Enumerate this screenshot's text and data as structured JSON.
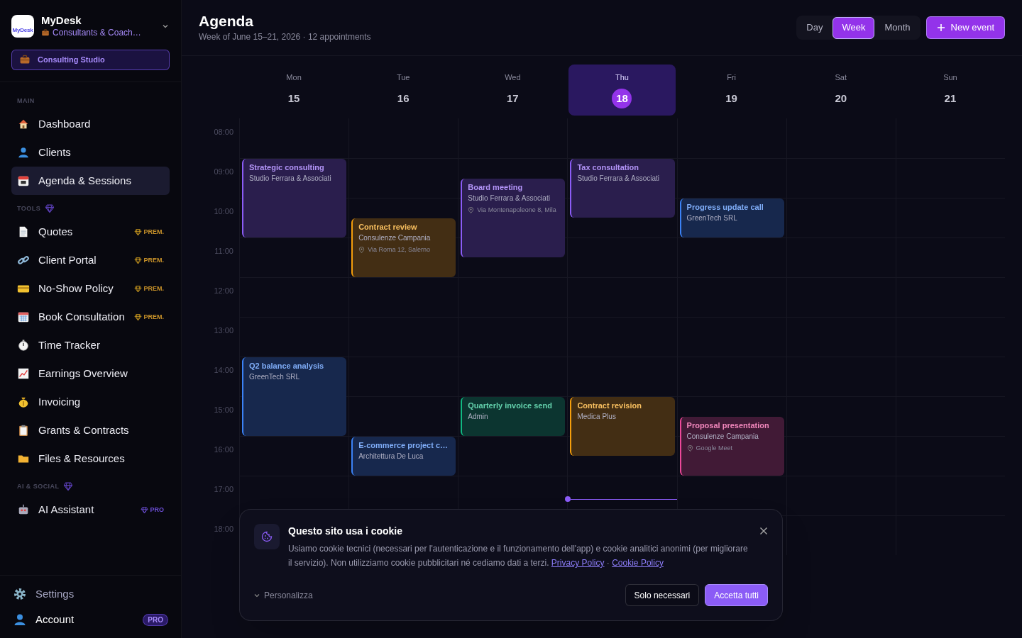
{
  "sidebar": {
    "logo_text": "MyDesk",
    "app_name": "MyDesk",
    "workspace": "Consultants & Coach…",
    "studio_button": "Consulting Studio",
    "sections": [
      {
        "label": "MAIN",
        "premium_icon": false,
        "items": [
          {
            "label": "Dashboard",
            "selected": false
          },
          {
            "label": "Clients",
            "selected": false
          },
          {
            "label": "Agenda & Sessions",
            "selected": true
          }
        ]
      },
      {
        "label": "TOOLS",
        "premium_icon": true,
        "items": [
          {
            "label": "Quotes",
            "selected": false,
            "badge": {
              "label": "PREM.",
              "kind": "premium"
            }
          },
          {
            "label": "Client Portal",
            "selected": false,
            "badge": {
              "label": "PREM.",
              "kind": "premium"
            }
          },
          {
            "label": "No-Show Policy",
            "selected": false,
            "badge": {
              "label": "PREM.",
              "kind": "premium"
            }
          },
          {
            "label": "Book Consultation",
            "selected": false,
            "badge": {
              "label": "PREM.",
              "kind": "premium"
            }
          },
          {
            "label": "Time Tracker",
            "selected": false
          },
          {
            "label": "Earnings Overview",
            "selected": false
          },
          {
            "label": "Invoicing",
            "selected": false
          },
          {
            "label": "Grants & Contracts",
            "selected": false
          },
          {
            "label": "Files & Resources",
            "selected": false
          }
        ]
      },
      {
        "label": "AI & SOCIAL",
        "premium_icon": true,
        "items": [
          {
            "label": "AI Assistant",
            "selected": false,
            "badge": {
              "label": "PRO",
              "kind": "pro"
            }
          }
        ]
      }
    ],
    "footer": [
      {
        "label": "Settings",
        "muted": true
      },
      {
        "label": "Account",
        "muted": false,
        "badge": "PRO"
      }
    ]
  },
  "header": {
    "title": "Agenda",
    "subtitle": "Week of June 15–21, 2026 · 12 appointments",
    "views": [
      {
        "label": "Day",
        "selected": false
      },
      {
        "label": "Week",
        "selected": true
      },
      {
        "label": "Month",
        "selected": false
      }
    ],
    "new_event_button": "New event"
  },
  "calendar": {
    "hours": [
      "08:00",
      "09:00",
      "10:00",
      "11:00",
      "12:00",
      "13:00",
      "14:00",
      "15:00",
      "16:00",
      "17:00",
      "18:00"
    ],
    "days": [
      {
        "weekday": "Mon",
        "date": "15",
        "selected": false,
        "events": [
          {
            "title": "Strategic consulting",
            "client": "Studio Ferrara & Associati",
            "color": "#8b5cf6"
          },
          {
            "title": "Q2 balance analysis",
            "client": "GreenTech SRL",
            "color": "#3b82f6"
          }
        ]
      },
      {
        "weekday": "Tue",
        "date": "16",
        "selected": false,
        "events": [
          {
            "title": "Contract review",
            "client": "Consulenze Campania",
            "location": "Via Roma 12, Salerno",
            "color": "#f59e0b"
          },
          {
            "title": "E-commerce project c…",
            "client": "Architettura De Luca",
            "color": "#3b82f6"
          }
        ]
      },
      {
        "weekday": "Wed",
        "date": "17",
        "selected": false,
        "events": [
          {
            "title": "Board meeting",
            "client": "Studio Ferrara & Associati",
            "location": "Via Montenapoleone 8, Mila",
            "color": "#8b5cf6"
          },
          {
            "title": "Quarterly invoice send",
            "client": "Admin",
            "color": "#10b981"
          }
        ]
      },
      {
        "weekday": "Thu",
        "date": "18",
        "selected": true,
        "events": [
          {
            "title": "Tax consultation",
            "client": "Studio Ferrara & Associati",
            "color": "#8b5cf6"
          },
          {
            "title": "Contract revision",
            "client": "Medica Plus",
            "color": "#f59e0b"
          }
        ]
      },
      {
        "weekday": "Fri",
        "date": "19",
        "selected": false,
        "events": [
          {
            "title": "Progress update call",
            "client": "GreenTech SRL",
            "color": "#3b82f6"
          },
          {
            "title": "Proposal presentation",
            "client": "Consulenze Campania",
            "location": "Google Meet",
            "color": "#ec4899"
          }
        ]
      },
      {
        "weekday": "Sat",
        "date": "20",
        "selected": false
      },
      {
        "weekday": "Sun",
        "date": "21",
        "selected": false
      }
    ]
  },
  "cookie_banner": {
    "title": "Questo sito usa i cookie",
    "text": "Usiamo cookie tecnici (necessari per l'autenticazione e il funzionamento dell'app) e cookie analitici anonimi (per migliorare il servizio). Non utilizziamo cookie pubblicitari né cediamo dati a terzi.",
    "links": [
      "Privacy Policy",
      "Cookie Policy"
    ],
    "link_separator": "·",
    "customize": "Personalizza",
    "buttons": [
      {
        "label": "Solo necessari",
        "kind": "secondary"
      },
      {
        "label": "Accetta tutti",
        "kind": "primary"
      }
    ]
  }
}
